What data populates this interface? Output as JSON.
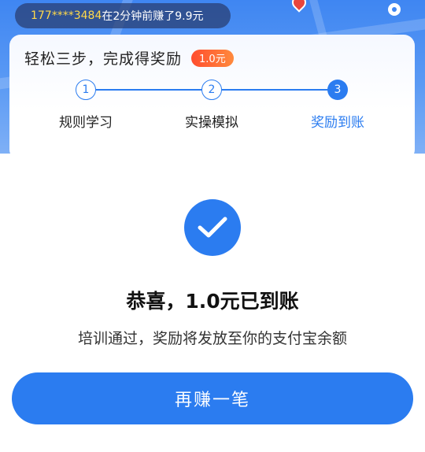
{
  "notice": {
    "phone": "177****3484",
    "message": "在2分钟前赚了9.9元"
  },
  "steps_card": {
    "title": "轻松三步，完成得奖励",
    "reward_badge": "1.0元",
    "steps": [
      {
        "number": "1",
        "label": "规则学习",
        "state": "done"
      },
      {
        "number": "2",
        "label": "实操模拟",
        "state": "done"
      },
      {
        "number": "3",
        "label": "奖励到账",
        "state": "active"
      }
    ]
  },
  "result": {
    "icon": "check-icon",
    "title": "恭喜，1.0元已到账",
    "description": "培训通过，奖励将发放至你的支付宝余额",
    "button_label": "再赚一笔"
  },
  "colors": {
    "accent": "#2b7cf0",
    "badge": "#ff5a2e",
    "notice_phone": "#ffd94a"
  }
}
